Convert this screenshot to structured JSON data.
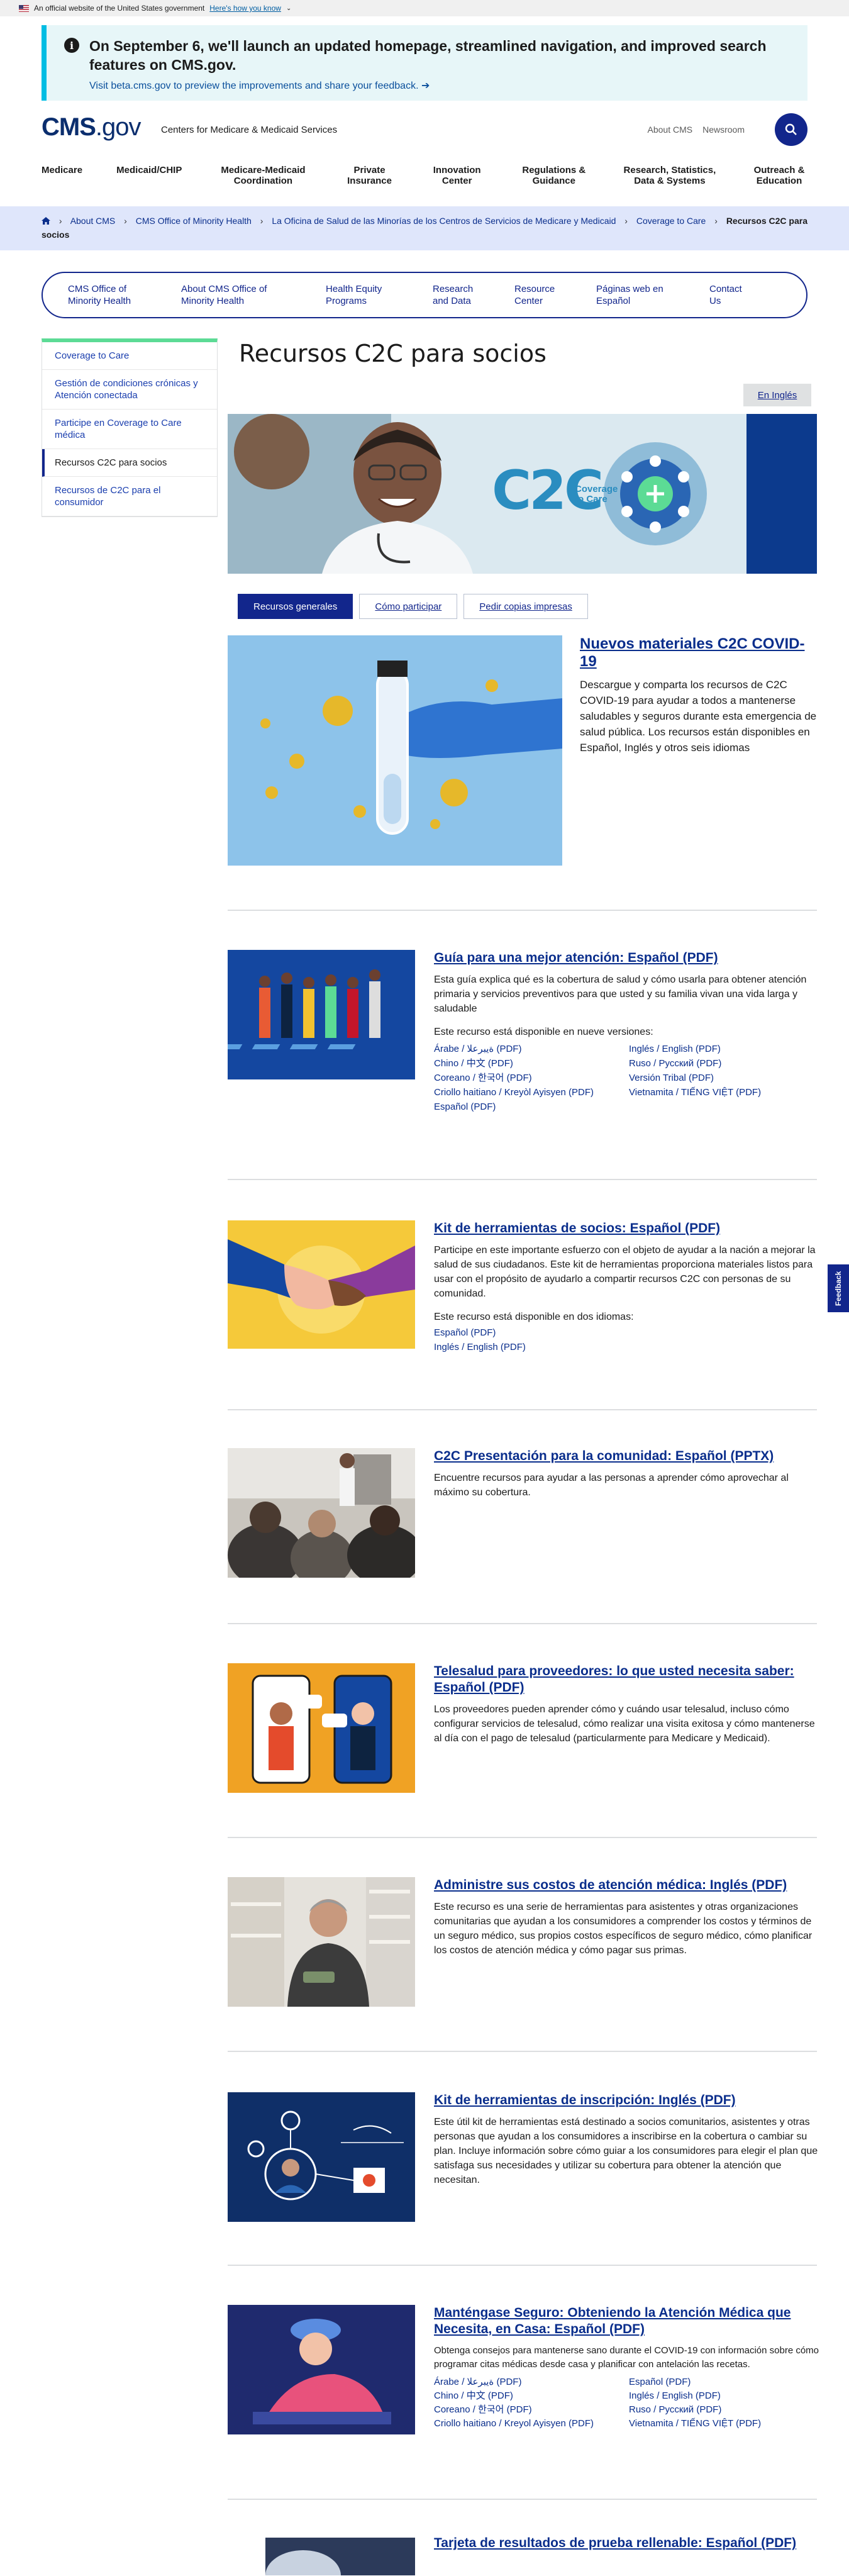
{
  "gov_banner": {
    "text": "An official website of the United States government",
    "link": "Here's how you know"
  },
  "alert": {
    "headline": "On September 6, we'll launch an updated homepage, streamlined navigation, and improved search features on CMS.gov.",
    "link": "Visit beta.cms.gov to preview the improvements and share your feedback. ➔"
  },
  "header": {
    "logo_main": "CMS",
    "logo_suffix": ".gov",
    "logo_text": "Centers for Medicare & Medicaid Services",
    "about": "About CMS",
    "newsroom": "Newsroom"
  },
  "nav": {
    "items": [
      "Medicare",
      "Medicaid/CHIP",
      "Medicare-Medicaid Coordination",
      "Private Insurance",
      "Innovation Center",
      "Regulations & Guidance",
      "Research, Statistics, Data & Systems",
      "Outreach & Education"
    ]
  },
  "breadcrumb": {
    "items": [
      "About CMS",
      "CMS Office of Minority Health",
      "La Oficina de Salud de las Minorías de los Centros de Servicios de Medicare y Medicaid",
      "Coverage to Care"
    ],
    "current": "Recursos C2C para socios"
  },
  "subnav": {
    "items": [
      "CMS Office of Minority Health",
      "About CMS Office of Minority Health",
      "Health Equity Programs",
      "Research and Data",
      "Resource Center",
      "Páginas web en Español",
      "Contact Us"
    ]
  },
  "sidebar": {
    "items": [
      "Coverage to Care",
      "Gestión de condiciones crónicas y Atención conectada",
      "Participe en Coverage to Care médica",
      "Recursos C2C para socios",
      "Recursos de C2C para el consumidor"
    ]
  },
  "page": {
    "title": "Recursos C2C para socios",
    "lang_button": "En Inglés",
    "hero_logo": "C2C",
    "hero_logo_sub": "Coverage to Care"
  },
  "tabs": [
    "Recursos generales",
    "Cómo participar",
    "Pedir copias impresas"
  ],
  "resources": [
    {
      "title": "Nuevos materiales C2C COVID-19",
      "desc": "Descargue y comparta los recursos de C2C COVID-19 para ayudar a todos a mantenerse saludables y seguros durante esta emergencia de salud pública. Los recursos están disponibles en Español, Inglés y otros seis idiomas"
    },
    {
      "title": "Guía para una mejor atención: Español (PDF)",
      "desc": "Esta guía explica qué es la cobertura de salud y cómo usarla para obtener atención primaria y servicios preventivos para que usted y su familia vivan una vida larga y saludable",
      "versions_label": "Este recurso está disponible en nueve versiones:",
      "versions": [
        "Árabe / ةيبرعلا (PDF)",
        "Inglés / English (PDF)",
        "Chino / 中文 (PDF)",
        "Ruso / Русский (PDF)",
        "Coreano / 한국어 (PDF)",
        "Versión Tribal (PDF)",
        "Criollo haitiano / Kreyòl Ayisyen (PDF)",
        "Vietnamita / TIẾNG VIỆT (PDF)",
        "Español (PDF)"
      ]
    },
    {
      "title": "Kit de herramientas de socios: Español (PDF)",
      "desc": "Participe en este importante esfuerzo con el objeto de ayudar a la nación a mejorar la salud de sus ciudadanos. Este kit de herramientas proporciona materiales listos para usar con el propósito de ayudarlo a compartir recursos C2C con personas de su comunidad.",
      "versions_label": "Este recurso está disponible en dos idiomas:",
      "versions": [
        "Español (PDF)",
        "Inglés / English (PDF)"
      ]
    },
    {
      "title": "C2C Presentación para la comunidad: Español (PPTX)",
      "desc": "Encuentre recursos para ayudar a las personas a aprender cómo aprovechar al máximo su cobertura."
    },
    {
      "title": "Telesalud para proveedores: lo que usted necesita saber: Español (PDF)",
      "desc": "Los proveedores pueden aprender cómo y cuándo usar telesalud, incluso cómo configurar servicios de telesalud, cómo realizar una visita exitosa y cómo mantenerse al día con el pago de telesalud (particularmente para Medicare y Medicaid)."
    },
    {
      "title": "Administre sus costos de atención médica: Inglés (PDF)",
      "desc": "Este recurso es una serie de herramientas para asistentes y otras organizaciones comunitarias que ayudan a los consumidores a comprender los costos y términos de un seguro médico, sus propios costos específicos de seguro médico, cómo planificar los costos de atención médica y cómo pagar sus primas."
    },
    {
      "title": "Kit de herramientas de inscripción: Inglés (PDF)",
      "desc": "Este útil kit de herramientas está destinado a socios comunitarios, asistentes y otras personas que ayudan a los consumidores a inscribirse en la cobertura o cambiar su plan. Incluye información sobre cómo guiar a los consumidores para elegir el plan que satisfaga sus necesidades y utilizar su cobertura para obtener la atención que necesitan."
    },
    {
      "title": "Manténgase Seguro: Obteniendo la Atención Médica que Necesita, en Casa: Español (PDF)",
      "desc": "Obtenga consejos para mantenerse sano durante el COVID-19 con información sobre cómo programar citas médicas desde casa y planificar con antelación las recetas.",
      "versions": [
        "Árabe / ةيبرعلا (PDF)",
        "Español (PDF)",
        "Chino / 中文 (PDF)",
        "Inglés / English (PDF)",
        "Coreano / 한국어 (PDF)",
        "Ruso / Русский (PDF)",
        "Criollo haitiano / Kreyol Ayisyen (PDF)",
        "Vietnamita / TIẾNG VIỆT (PDF)"
      ]
    },
    {
      "title": "Tarjeta de resultados de prueba rellenable: Español (PDF)"
    }
  ],
  "feedback": "Feedback",
  "colors": {
    "primary": "#12268c",
    "alert_bg": "#e7f6f8",
    "alert_border": "#00bde3",
    "breadcrumb_bg": "#dfe6fb",
    "sidebar_accent": "#5cdb95"
  }
}
